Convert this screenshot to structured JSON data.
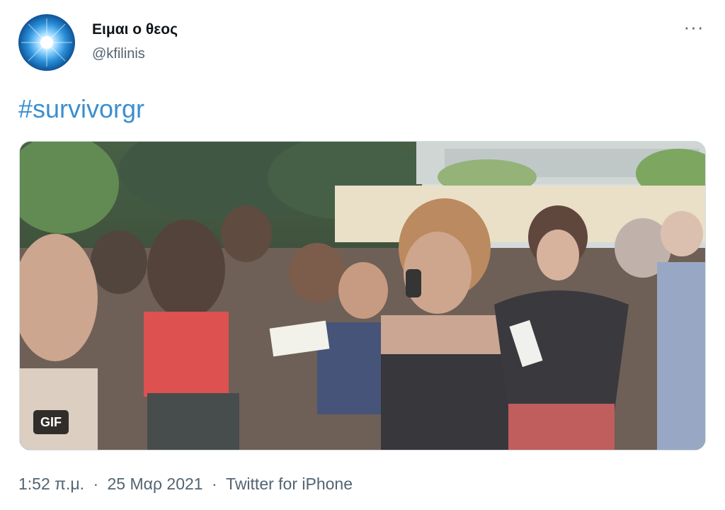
{
  "author": {
    "display_name": "Ειμαι ο θεος",
    "handle": "@kfilinis",
    "avatar_icon": "starburst-avatar-icon"
  },
  "more_menu": {
    "label": "···",
    "icon": "more-options-icon"
  },
  "tweet": {
    "text": "#survivorgr"
  },
  "media": {
    "type": "gif",
    "badge": "GIF",
    "description_icon": "protest-video-frame"
  },
  "meta": {
    "time": "1:52 π.μ.",
    "separator": "·",
    "date": "25 Μαρ 2021",
    "source": "Twitter for iPhone"
  },
  "colors": {
    "hashtag": "#3a8fd0",
    "name": "#0f1419",
    "secondary": "#536471"
  }
}
